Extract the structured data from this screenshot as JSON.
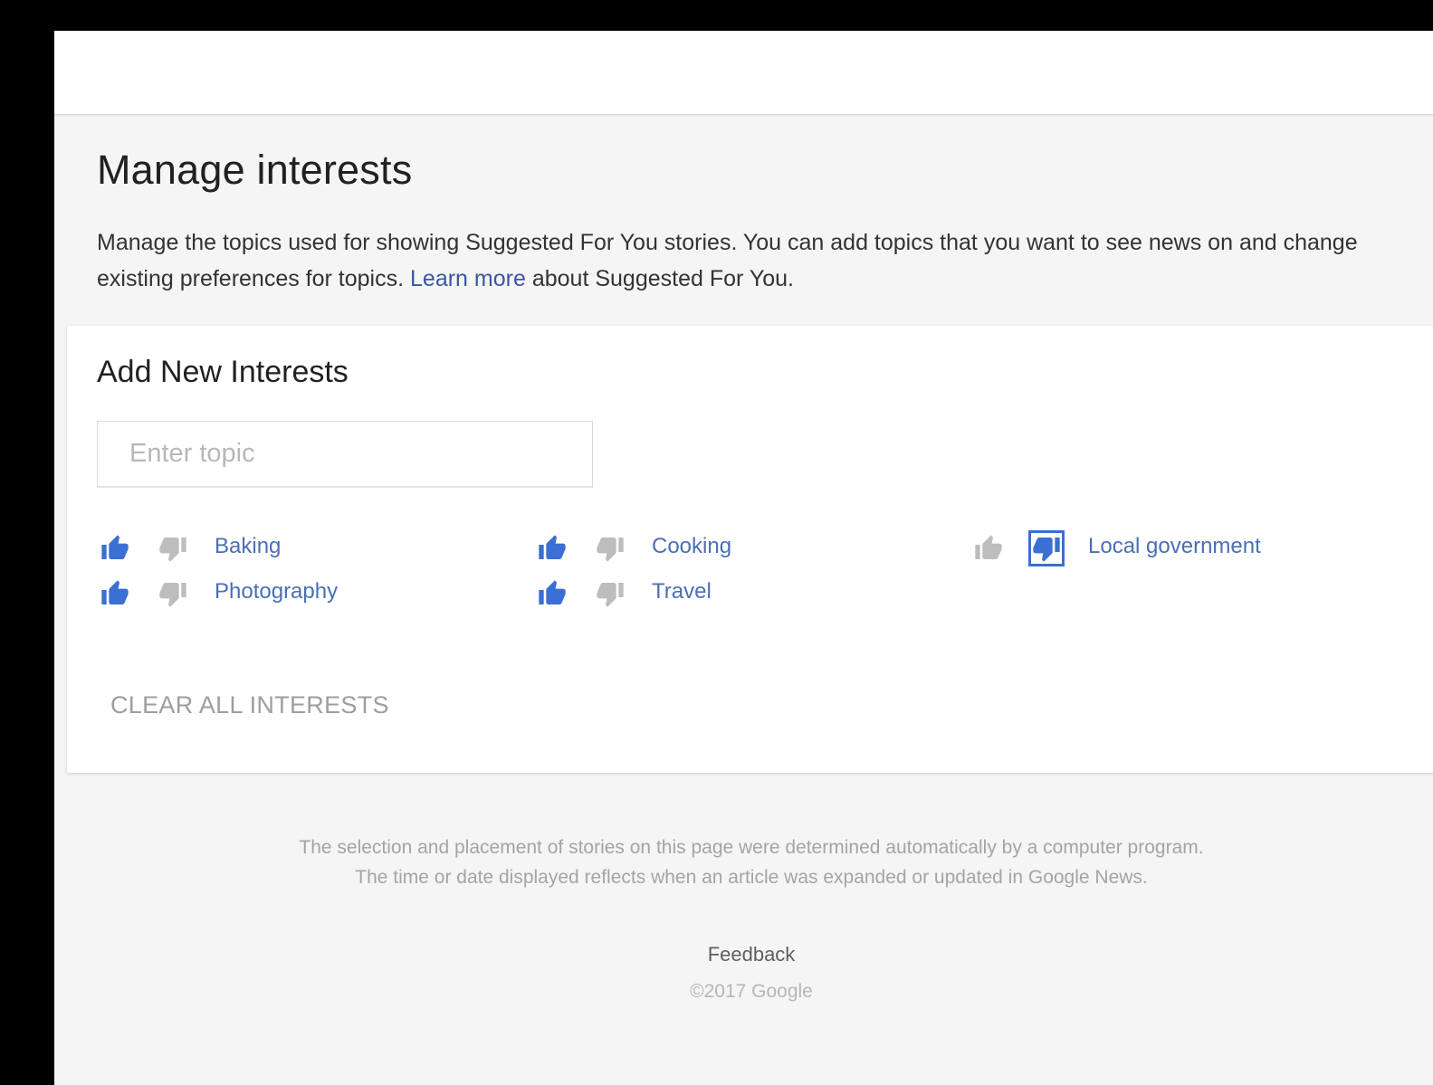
{
  "page": {
    "title": "Manage interests",
    "intro_text": "Manage the topics used for showing Suggested For You stories. You can add topics that you want to see news on and change existing preferences for topics.",
    "learn_more_link": "Learn more",
    "intro_suffix": "about Suggested For You."
  },
  "add_interests": {
    "title": "Add New Interests",
    "input_placeholder": "Enter topic",
    "input_value": ""
  },
  "interests": [
    {
      "label": "Baking",
      "preference": "liked"
    },
    {
      "label": "Cooking",
      "preference": "liked"
    },
    {
      "label": "Local government",
      "preference": "disliked"
    },
    {
      "label": "Photography",
      "preference": "liked"
    },
    {
      "label": "Travel",
      "preference": "liked"
    }
  ],
  "clear_all_label": "CLEAR ALL INTERESTS",
  "footer": {
    "disclaimer_line1": "The selection and placement of stories on this page were determined automatically by a computer program.",
    "disclaimer_line2": "The time or date displayed reflects when an article was expanded or updated in Google News.",
    "feedback_label": "Feedback",
    "copyright": "©2017 Google"
  },
  "icons": {
    "like": "thumbs-up-icon",
    "dislike": "thumbs-down-icon"
  },
  "colors": {
    "accent": "#3a55a4",
    "active_icon": "#3a6fd4",
    "inactive_icon": "#bdbdbd",
    "topic_link": "#4a6fb5"
  }
}
